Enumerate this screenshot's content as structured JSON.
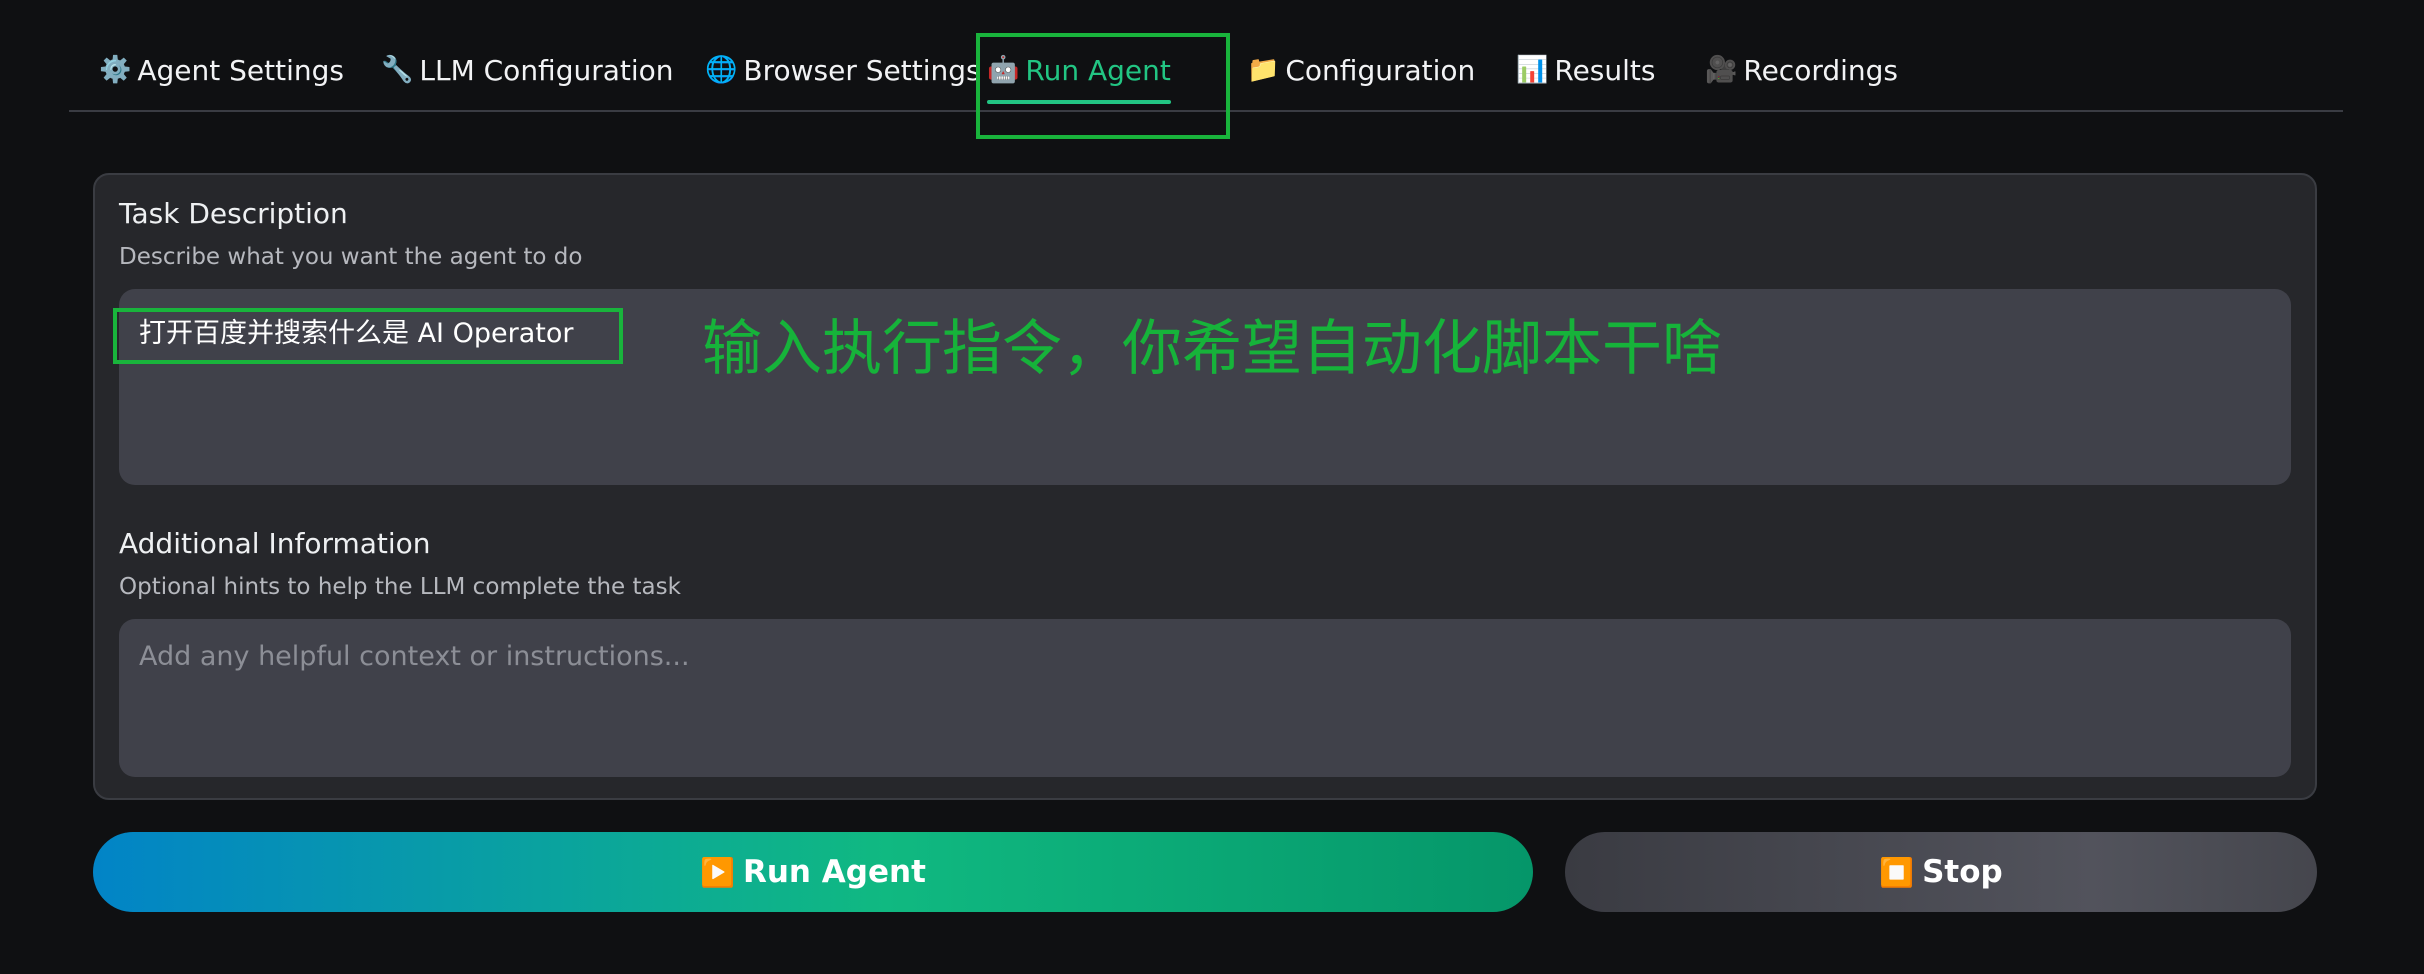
{
  "tabs": [
    {
      "icon": "⚙️",
      "label": "Agent Settings"
    },
    {
      "icon": "🔧",
      "label": "LLM Configuration"
    },
    {
      "icon": "🌐",
      "label": "Browser Settings"
    },
    {
      "icon": "🤖",
      "label": "Run Agent"
    },
    {
      "icon": "📁",
      "label": "Configuration"
    },
    {
      "icon": "📊",
      "label": "Results"
    },
    {
      "icon": "🎥",
      "label": "Recordings"
    }
  ],
  "active_tab": "Run Agent",
  "task": {
    "label": "Task Description",
    "hint": "Describe what you want the agent to do",
    "value": "打开百度并搜索什么是 AI Operator"
  },
  "additional": {
    "label": "Additional Information",
    "hint": "Optional hints to help the LLM complete the task",
    "placeholder": "Add any helpful context or instructions..."
  },
  "annotation": {
    "note": "输入执行指令，你希望自动化脚本干啥",
    "color": "#19b43c"
  },
  "buttons": {
    "run": {
      "icon": "▶️",
      "label": "Run Agent"
    },
    "stop": {
      "icon": "⏹️",
      "label": "Stop"
    }
  },
  "colors": {
    "accent": "#22c583",
    "background": "#0f1012",
    "panel": "#26272b",
    "input": "#40414a"
  }
}
